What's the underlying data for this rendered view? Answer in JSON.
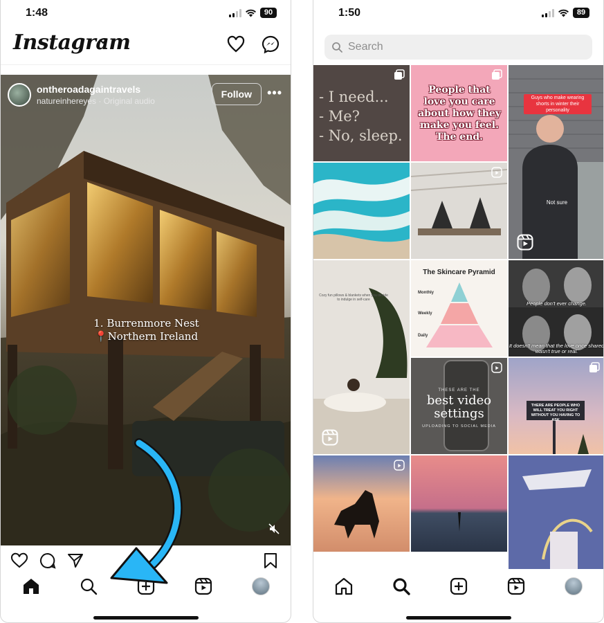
{
  "left_phone": {
    "status": {
      "time": "1:48",
      "battery": "90"
    },
    "header": {
      "logo": "Instagram"
    },
    "post": {
      "author": "ontheroadagaintravels",
      "audio": "natureinhereyes · Original audio",
      "follow_label": "Follow",
      "caption_line1": "1. Burrenmore Nest",
      "caption_line2": "📍Northern Ireland"
    }
  },
  "right_phone": {
    "status": {
      "time": "1:50",
      "battery": "89"
    },
    "search": {
      "placeholder": "Search"
    },
    "tiles": {
      "need_text": [
        "- I need...",
        "- Me?",
        "- No, sleep."
      ],
      "pink_quote": "People that love you care about how they make you feel. The end.",
      "guys_label": "Guys who make wearing shorts in winter their personality",
      "not_sure": "Not sure",
      "pyramid": {
        "title": "The Skincare Pyramid",
        "top": "Monthly",
        "middle": "Weekly",
        "bottom": "Daily"
      },
      "movie_top": "People don't ever change.",
      "movie_bottom": "It doesn't mean that the love once shared wasn't true or real.",
      "video_top": "THESE ARE THE",
      "video_main": "best video settings",
      "video_bottom": "UPLOADING TO SOCIAL MEDIA",
      "billboard": "THERE ARE PEOPLE WHO WILL TREAT YOU RIGHT WITHOUT YOU HAVING TO ASK"
    }
  },
  "colors": {
    "annotation_arrow": "#29b6f6",
    "ig_text": "#111111"
  }
}
